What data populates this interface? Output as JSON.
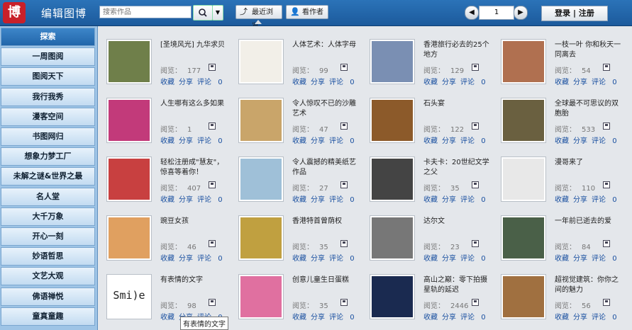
{
  "header": {
    "logo_text": "博",
    "title": "编辑图博",
    "search_placeholder": "搜索作品",
    "search_icon": "magnifier-icon",
    "recent_label": "最近浏览",
    "author_label": "看作者",
    "page_number": "1",
    "login_label": "登录 | 注册"
  },
  "sidebar": {
    "items": [
      "探索",
      "一周图阅",
      "图阅天下",
      "我行我秀",
      "漫客空间",
      "书图网归",
      "想象力梦工厂",
      "未解之谜&世界之最",
      "名人堂",
      "大千万象",
      "开心一刻",
      "妙语哲思",
      "文艺大观",
      "佛语禅悦",
      "童真童趣"
    ]
  },
  "labels": {
    "views": "阅览：",
    "favorite": "收藏",
    "share": "分享",
    "comment": "评论"
  },
  "items": [
    {
      "title": "[圣境风光] 九华求贝",
      "views": "177",
      "comments": "0",
      "color": "#6f7f4a"
    },
    {
      "title": "人体艺术：人体字母",
      "views": "99",
      "comments": "0",
      "color": "#f2efe8"
    },
    {
      "title": "香港旅行必去的25个地方",
      "views": "129",
      "comments": "0",
      "color": "#7a8fb3"
    },
    {
      "title": "一枝一叶 你和秋天一同离去",
      "views": "54",
      "comments": "0",
      "color": "#b07050"
    },
    {
      "title": "人生哪有这么多如果",
      "views": "1",
      "comments": "0",
      "color": "#c23a7a"
    },
    {
      "title": "令人惊叹不已的沙雕艺术",
      "views": "47",
      "comments": "0",
      "color": "#c9a56a"
    },
    {
      "title": "石头宴",
      "views": "122",
      "comments": "0",
      "color": "#8c5a2a"
    },
    {
      "title": "全球最不可思议的双胞胎",
      "views": "533",
      "comments": "0",
      "color": "#6a6040"
    },
    {
      "title": "轻松注册成\"慧友\"，惊喜等着你！",
      "views": "407",
      "comments": "0",
      "color": "#c84040"
    },
    {
      "title": "令人震撼的精美纸艺作品",
      "views": "27",
      "comments": "0",
      "color": "#9fc0d8"
    },
    {
      "title": "卡夫卡：20世纪文学之父",
      "views": "35",
      "comments": "0",
      "color": "#444444"
    },
    {
      "title": "漫哥来了",
      "views": "110",
      "comments": "0",
      "color": "#e8e8e8"
    },
    {
      "title": "豌豆女孩",
      "views": "46",
      "comments": "0",
      "color": "#e0a060"
    },
    {
      "title": "香港特首曾荫权",
      "views": "35",
      "comments": "0",
      "color": "#c0a040"
    },
    {
      "title": "达尔文",
      "views": "23",
      "comments": "0",
      "color": "#777777"
    },
    {
      "title": "一年前已逝去的爱",
      "views": "84",
      "comments": "0",
      "color": "#4a6048"
    },
    {
      "title": "有表情的文字",
      "views": "98",
      "comments": "0",
      "color": "#ffffff",
      "thumb_text": "Smi)e"
    },
    {
      "title": "创意儿童生日蛋糕",
      "views": "35",
      "comments": "0",
      "color": "#e070a0"
    },
    {
      "title": "高山之巅：零下拍摄星轨的延迟",
      "views": "2446",
      "comments": "0",
      "color": "#1a2a50"
    },
    {
      "title": "超视觉建筑：你你之间的魅力",
      "views": "56",
      "comments": "0",
      "color": "#a07040"
    }
  ],
  "tooltip": "有表情的文字"
}
